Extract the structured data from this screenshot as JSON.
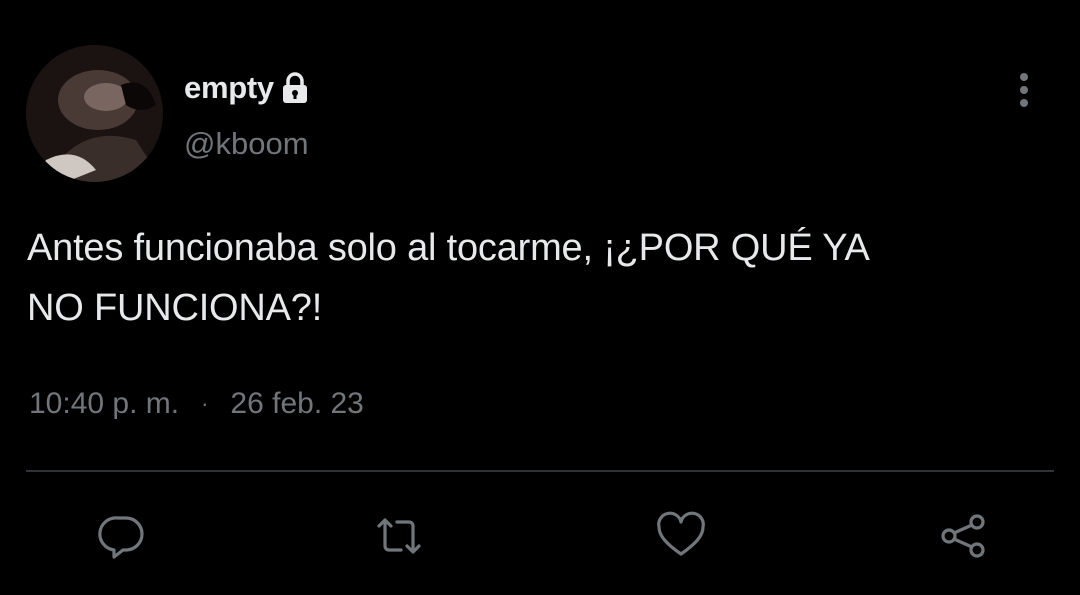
{
  "user": {
    "display_name": "empty",
    "handle": "@kboom",
    "protected_icon": "lock-icon",
    "avatar": "avatar-photo"
  },
  "tweet": {
    "text_line1": "Antes funcionaba solo al tocarme, ¡¿POR QUÉ YA",
    "text_line2": "NO FUNCIONA?!",
    "time": "10:40 p. m.",
    "separator": "·",
    "date": "26 feb. 23"
  },
  "actions": [
    {
      "icon": "reply-icon"
    },
    {
      "icon": "retweet-icon"
    },
    {
      "icon": "like-icon"
    },
    {
      "icon": "share-icon"
    }
  ],
  "menu": {
    "icon": "more-vertical-icon"
  },
  "colors": {
    "background": "#000000",
    "text_primary": "#e7e9ea",
    "text_secondary": "#71767b",
    "divider": "#2f3336"
  }
}
